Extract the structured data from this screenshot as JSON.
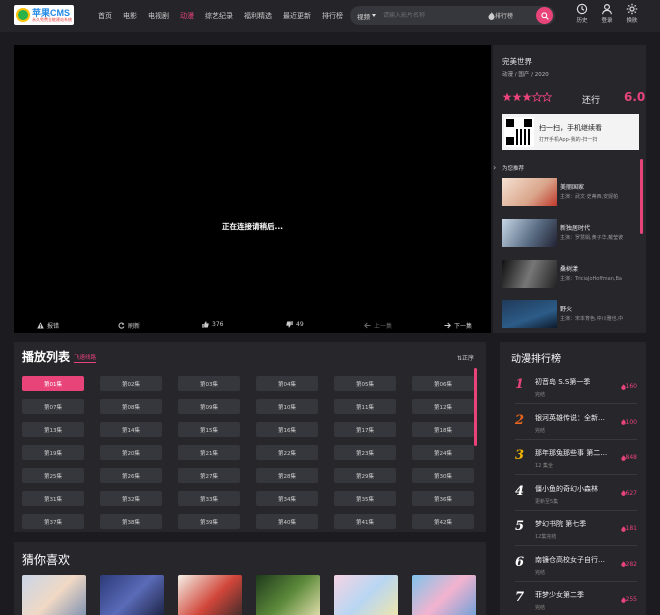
{
  "header": {
    "logo_text": "苹果CMS",
    "logo_sub": "永久免费全能建站系统",
    "nav": [
      {
        "label": "首页",
        "active": false
      },
      {
        "label": "电影",
        "active": false
      },
      {
        "label": "电视剧",
        "active": false
      },
      {
        "label": "动漫",
        "active": true
      },
      {
        "label": "综艺纪录",
        "active": false
      },
      {
        "label": "福利精选",
        "active": false
      },
      {
        "label": "最近更新",
        "active": false
      },
      {
        "label": "排行榜",
        "active": false
      }
    ],
    "search": {
      "type_label": "视频",
      "placeholder": "请输入影片名称",
      "rank_label": "排行榜"
    },
    "icons": [
      {
        "label": "历史",
        "icon": "history-icon"
      },
      {
        "label": "登录",
        "icon": "user-icon"
      },
      {
        "label": "换肤",
        "icon": "gear-icon"
      }
    ]
  },
  "player": {
    "message": "正在连接请稍后...",
    "controls": {
      "report": "报错",
      "refresh": "刷新",
      "likes": "376",
      "dislikes": "49",
      "prev": "上一集",
      "next": "下一集"
    }
  },
  "info": {
    "title": "完美世界",
    "meta": "动漫 / 国产 / 2020",
    "rating_stars": 3,
    "status": "还行",
    "score": "6.0",
    "qr_line1": "扫一扫，手机继续看",
    "qr_line2": "打开手机App-我的-扫一扫",
    "rec_header": "为您推荐",
    "recommendations": [
      {
        "name": "美丽国家",
        "cast": "主演：武文·史蒂西,安妮帕"
      },
      {
        "name": "新独居时代",
        "cast": "主演：罗慧娟,黄子华,戴莹彼"
      },
      {
        "name": "桑树漾",
        "cast": "主演：TriciaJoHoffman,Ba"
      },
      {
        "name": "野火",
        "cast": "主演：宋本育色,中川雅也,中"
      }
    ]
  },
  "playlist": {
    "title": "播放列表",
    "line": "飞速线路",
    "sort": "正序",
    "episodes": [
      "第01集",
      "第02集",
      "第03集",
      "第04集",
      "第05集",
      "第06集",
      "第07集",
      "第08集",
      "第09集",
      "第10集",
      "第11集",
      "第12集",
      "第13集",
      "第14集",
      "第15集",
      "第16集",
      "第17集",
      "第18集",
      "第19集",
      "第20集",
      "第21集",
      "第22集",
      "第23集",
      "第24集",
      "第25集",
      "第26集",
      "第27集",
      "第28集",
      "第29集",
      "第30集",
      "第31集",
      "第32集",
      "第33集",
      "第34集",
      "第35集",
      "第36集",
      "第37集",
      "第38集",
      "第39集",
      "第40集",
      "第41集",
      "第42集"
    ],
    "active_index": 0
  },
  "guess": {
    "title": "猜你喜欢"
  },
  "ranking": {
    "title": "动漫排行榜",
    "items": [
      {
        "rank": "1",
        "name": "初音岛 S.S第一季",
        "status": "完结",
        "hits": "160"
      },
      {
        "rank": "2",
        "name": "银河英雄传说：全新…",
        "status": "完结",
        "hits": "100"
      },
      {
        "rank": "3",
        "name": "那年那兔那些事 第二…",
        "status": "12 集全",
        "hits": "848"
      },
      {
        "rank": "4",
        "name": "僵小鱼的奇幻小森林",
        "status": "更新至5集",
        "hits": "627"
      },
      {
        "rank": "5",
        "name": "梦幻书院 第七季",
        "status": "12集完结",
        "hits": "181"
      },
      {
        "rank": "6",
        "name": "南镰仓高校女子自行…",
        "status": "完结",
        "hits": "282"
      },
      {
        "rank": "7",
        "name": "菲梦少女第二季",
        "status": "完结",
        "hits": "255"
      }
    ]
  },
  "colors": {
    "accent": "#e8447a",
    "panel": "#26262b",
    "bg": "#1b1b20"
  }
}
